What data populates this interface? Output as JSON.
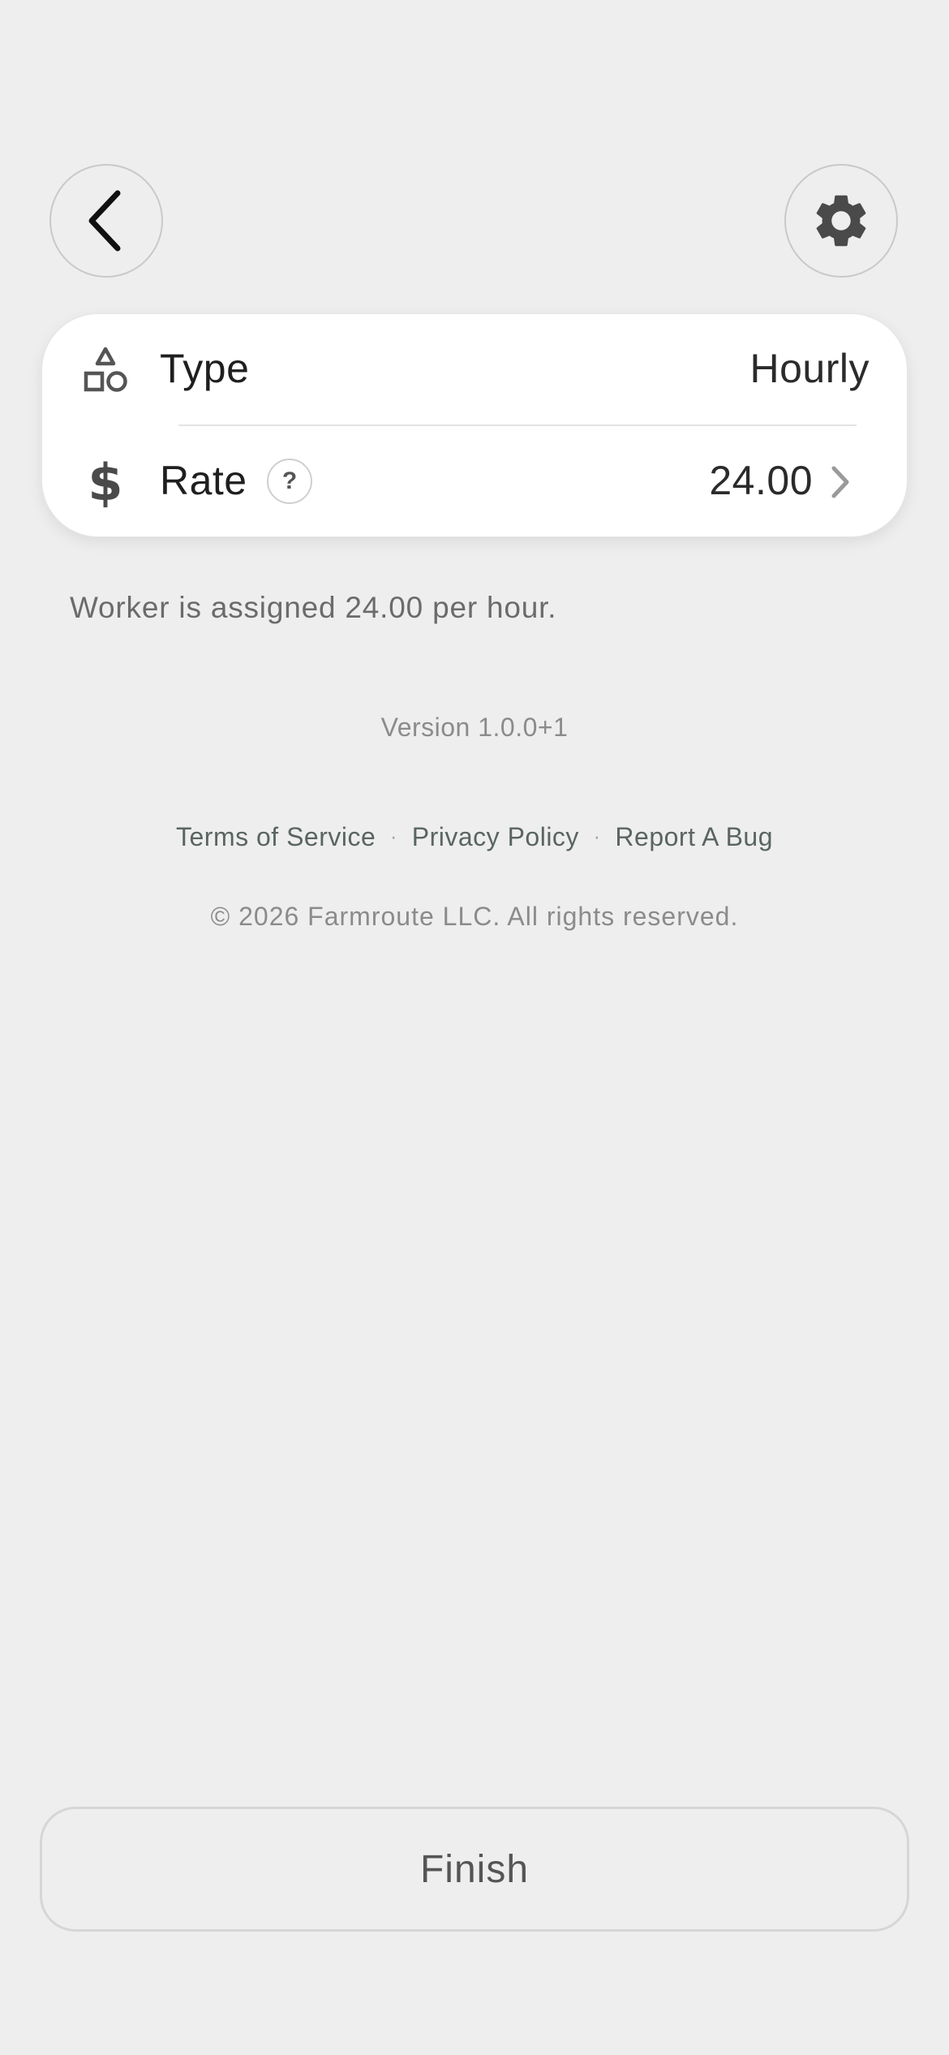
{
  "header": {
    "back_icon": "chevron-left-icon",
    "settings_icon": "gear-icon"
  },
  "card": {
    "type_row": {
      "icon": "shapes-icon",
      "label": "Type",
      "value": "Hourly"
    },
    "rate_row": {
      "icon": "dollar-icon",
      "label": "Rate",
      "help": "?",
      "value": "24.00",
      "chevron": "chevron-right-icon"
    }
  },
  "info_text": "Worker is assigned 24.00 per hour.",
  "footer": {
    "version": "Version 1.0.0+1",
    "links": [
      "Terms of Service",
      "Privacy Policy",
      "Report A Bug"
    ],
    "separator": "·",
    "copyright": "© 2026 Farmroute LLC. All rights reserved."
  },
  "finish_button": "Finish",
  "colors": {
    "background": "#eeeeee",
    "card": "#ffffff",
    "icon_dark": "#555555",
    "link": "#5a6560"
  }
}
